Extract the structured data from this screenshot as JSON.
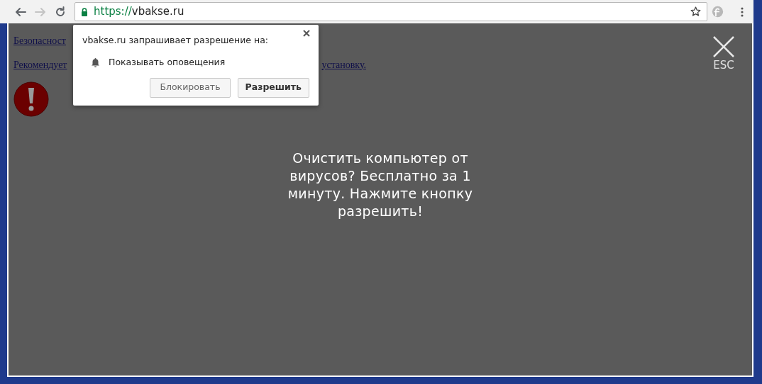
{
  "browser": {
    "nav": [
      {
        "kind": "back",
        "disabled": false
      },
      {
        "kind": "forward",
        "disabled": true
      },
      {
        "kind": "reload",
        "disabled": false
      }
    ],
    "address": {
      "scheme": "https://",
      "host": "vbakse.ru",
      "secure": true
    },
    "bookmarked": false
  },
  "page": {
    "lines": [
      {
        "parts": [
          "Безопасност"
        ]
      },
      {
        "parts": [
          "Рекомендует",
          "установку."
        ]
      }
    ]
  },
  "overlay": {
    "message": "Очистить компьютер от вирусов? Бесплатно за 1 минуту. Нажмите кнопку разрешить!",
    "close_label": "ESC"
  },
  "permission_prompt": {
    "title": "vbakse.ru запрашивает разрешение на:",
    "permission": "Показывать оповещения",
    "buttons": [
      {
        "label": "Блокировать",
        "primary": false
      },
      {
        "label": "Разрешить",
        "primary": true
      }
    ]
  }
}
